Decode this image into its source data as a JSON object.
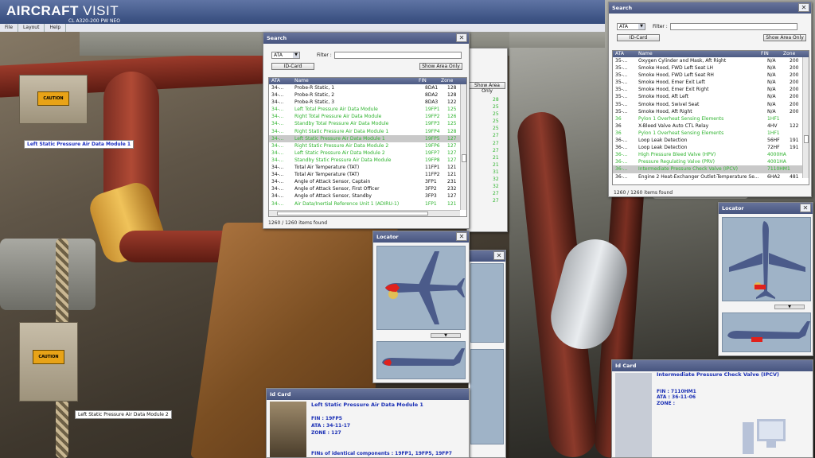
{
  "app": {
    "logo_bold": "AIRCRAFT",
    "logo_thin": "VISIT",
    "subtitle": "CL A320-200 PW NEO"
  },
  "menu": [
    {
      "label": "File"
    },
    {
      "label": "Layout"
    },
    {
      "label": "Help"
    }
  ],
  "search_left": {
    "title": "Search",
    "filter_select": "ATA",
    "filter_label": "Filter :",
    "filter_value": "",
    "id_card_btn": "ID-Card",
    "show_area_btn": "Show Area Only",
    "columns": {
      "ata": "ATA",
      "name": "Name",
      "fin": "FIN",
      "zone": "Zone"
    },
    "rows": [
      {
        "ata": "34-...",
        "name": "Probe-R Static, 1",
        "fin": "8DA1",
        "zone": "128",
        "style": "normal"
      },
      {
        "ata": "34-...",
        "name": "Probe-R Static, 2",
        "fin": "8DA2",
        "zone": "128",
        "style": "normal"
      },
      {
        "ata": "34-...",
        "name": "Probe-R Static, 3",
        "fin": "8DA3",
        "zone": "122",
        "style": "normal"
      },
      {
        "ata": "34-...",
        "name": "Left Total Pressure Air Data Module",
        "fin": "19FP1",
        "zone": "125",
        "style": "green"
      },
      {
        "ata": "34-...",
        "name": "Right Total Pressure Air Data Module",
        "fin": "19FP2",
        "zone": "126",
        "style": "green"
      },
      {
        "ata": "34-...",
        "name": "Standby Total Pressure Air Data Module",
        "fin": "19FP3",
        "zone": "125",
        "style": "green"
      },
      {
        "ata": "34-...",
        "name": "Right Static Pressure Air Data Module 1",
        "fin": "19FP4",
        "zone": "128",
        "style": "green"
      },
      {
        "ata": "34-...",
        "name": "Left Static Pressure Air Data Module 1",
        "fin": "19FP5",
        "zone": "127",
        "style": "selected"
      },
      {
        "ata": "34-...",
        "name": "Right Static Pressure Air Data Module 2",
        "fin": "19FP6",
        "zone": "127",
        "style": "green"
      },
      {
        "ata": "34-...",
        "name": "Left Static Pressure Air Data Module 2",
        "fin": "19FP7",
        "zone": "127",
        "style": "green"
      },
      {
        "ata": "34-...",
        "name": "Standby Static Pressure Air Data Module",
        "fin": "19FP8",
        "zone": "127",
        "style": "green"
      },
      {
        "ata": "34-...",
        "name": "Total Air Temperature (TAT)",
        "fin": "11FP1",
        "zone": "121",
        "style": "normal"
      },
      {
        "ata": "34-...",
        "name": "Total Air Temperature (TAT)",
        "fin": "11FP2",
        "zone": "121",
        "style": "normal"
      },
      {
        "ata": "34-...",
        "name": "Angle of Attack Sensor, Captain",
        "fin": "3FP1",
        "zone": "231",
        "style": "normal"
      },
      {
        "ata": "34-...",
        "name": "Angle of Attack Sensor, First Officer",
        "fin": "3FP2",
        "zone": "232",
        "style": "normal"
      },
      {
        "ata": "34-...",
        "name": "Angle of Attack Sensor, Standby",
        "fin": "3FP3",
        "zone": "127",
        "style": "normal"
      },
      {
        "ata": "34-...",
        "name": "Air Data/Inertial Reference Unit 1 (ADIRU-1)",
        "fin": "1FP1",
        "zone": "121",
        "style": "green"
      }
    ],
    "status": "1260 / 1260 items found"
  },
  "search_right": {
    "title": "Search",
    "filter_select": "ATA",
    "filter_label": "Filter :",
    "filter_value": "",
    "id_card_btn": "ID-Card",
    "show_area_btn": "Show Area Only",
    "columns": {
      "ata": "ATA",
      "name": "Name",
      "fin": "FIN",
      "zone": "Zone"
    },
    "rows": [
      {
        "ata": "35-...",
        "name": "Oxygen Cylinder and Mask, Aft Right",
        "fin": "N/A",
        "zone": "200",
        "style": "normal"
      },
      {
        "ata": "35-...",
        "name": "Smoke Hood, FWD Left Seat LH",
        "fin": "N/A",
        "zone": "200",
        "style": "normal"
      },
      {
        "ata": "35-...",
        "name": "Smoke Hood, FWD Left Seat RH",
        "fin": "N/A",
        "zone": "200",
        "style": "normal"
      },
      {
        "ata": "35-...",
        "name": "Smoke Hood, Emer Exit Left",
        "fin": "N/A",
        "zone": "200",
        "style": "normal"
      },
      {
        "ata": "35-...",
        "name": "Smoke Hood, Emer Exit Right",
        "fin": "N/A",
        "zone": "200",
        "style": "normal"
      },
      {
        "ata": "35-...",
        "name": "Smoke Hood, Aft Left",
        "fin": "N/A",
        "zone": "200",
        "style": "normal"
      },
      {
        "ata": "35-...",
        "name": "Smoke Hood, Swivel Seat",
        "fin": "N/A",
        "zone": "200",
        "style": "normal"
      },
      {
        "ata": "35-...",
        "name": "Smoke Hood, Aft Right",
        "fin": "N/A",
        "zone": "200",
        "style": "normal"
      },
      {
        "ata": "36",
        "name": "Pylon 1 Overheat Sensing Elements",
        "fin": "1HF1",
        "zone": "",
        "style": "green"
      },
      {
        "ata": "36",
        "name": "X-Bleed Valve Auto CTL Relay",
        "fin": "4HV",
        "zone": "122",
        "style": "normal"
      },
      {
        "ata": "36",
        "name": "Pylon 1 Overheat Sensing Elements",
        "fin": "1HF1",
        "zone": "",
        "style": "green"
      },
      {
        "ata": "36-...",
        "name": "Loop Leak Detection",
        "fin": "56HF",
        "zone": "191",
        "style": "normal"
      },
      {
        "ata": "36-...",
        "name": "Loop Leak Detection",
        "fin": "72HF",
        "zone": "191",
        "style": "normal"
      },
      {
        "ata": "36-...",
        "name": "High Pressure Bleed Valve (HPV)",
        "fin": "4000HA",
        "zone": "",
        "style": "green"
      },
      {
        "ata": "36-...",
        "name": "Pressure Regulating Valve (PRV)",
        "fin": "4001HA",
        "zone": "",
        "style": "green"
      },
      {
        "ata": "36-...",
        "name": "Intermediate Pressure Check Valve (IPCV)",
        "fin": "7110HM1",
        "zone": "",
        "style": "selected"
      },
      {
        "ata": "36-...",
        "name": "Engine 2 Heat-Exchanger Outlet-Temperature Se...",
        "fin": "6HA2",
        "zone": "481",
        "style": "normal"
      }
    ],
    "status": "1260 / 1260 items found"
  },
  "locator_left": {
    "title": "Locator"
  },
  "locator_right": {
    "title": "Locator"
  },
  "idcard_left": {
    "title": "Id Card",
    "name": "Left Static Pressure Air Data Module 1",
    "fin": "FIN : 19FP5",
    "ata": "ATA : 34-11-17",
    "zone": "ZONE : 127",
    "identical": "FINs of identical components : 19FP1, 19FP5, 19FP7"
  },
  "idcard_right": {
    "title": "Id Card",
    "name": "Intermediate Pressure Check Valve (IPCV)",
    "fin": "FIN : 7110HM1",
    "ata": "ATA : 36-11-06",
    "zone": "ZONE :"
  },
  "labels3d": [
    {
      "text": "Left Static Pressure Air Data Module 1"
    },
    {
      "text": "Left Static Pressure Air Data Module 2"
    }
  ],
  "background_panel": {
    "show_area_btn": "Show Area Only",
    "zones": [
      "28",
      "25",
      "25",
      "25",
      "25",
      "27",
      "27",
      "27",
      "21",
      "21",
      "31",
      "32",
      "32",
      "27",
      "27"
    ]
  },
  "caution": {
    "text": "CAUTION"
  },
  "colors": {
    "accent": "#47557f",
    "green_row": "#2fb32f",
    "idcard_blue": "#1a2fb5",
    "highlight": "#e0211c"
  }
}
